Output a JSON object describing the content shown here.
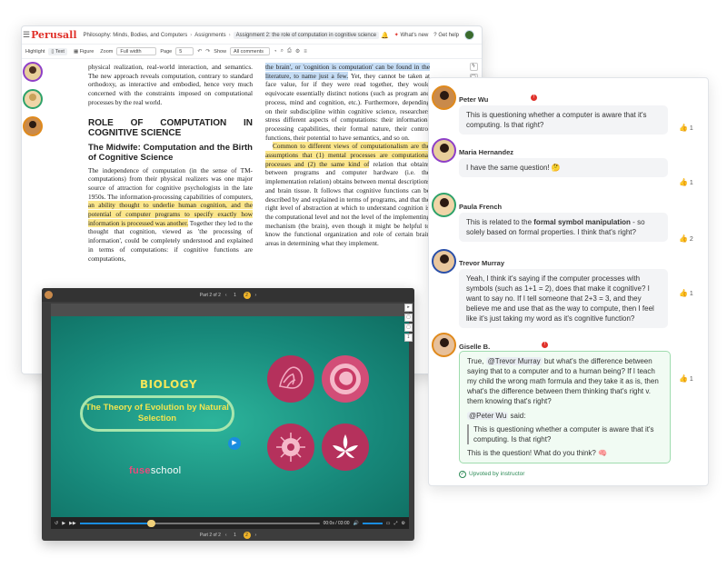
{
  "reader": {
    "logo": "Perusall",
    "breadcrumb": [
      "Philosophy: Minds, Bodies, and Computers",
      "Assignments",
      "Assignment 2: the role of computation in cognitive science"
    ],
    "whats_new": "What's new",
    "get_help": "Get help",
    "toolbar": {
      "highlight": "Highlight",
      "text": "Text",
      "figure": "Figure",
      "zoom_label": "Zoom",
      "zoom_value": "Full width",
      "page_label": "Page",
      "page_value": "5",
      "show_label": "Show",
      "show_value": "All comments"
    },
    "doc": {
      "col1_p1": "physical realization, real-world interaction, and semantics. The new approach reveals computation, contrary to standard orthodoxy, as interactive and embodied, hence very much concerned with the constraints imposed on computational processes by the real world.",
      "heading1": "ROLE OF COMPUTATION IN COGNITIVE SCIENCE",
      "heading2": "The Midwife: Computation and the Birth of Cognitive Science",
      "col1_p2a": "The independence of computation (in the sense of TM- computations) from their physical realizers was one major source of attraction for cognitive psychologists in the late 1950s. The information-processing capabilities of computers, ",
      "col1_p2_hl": "an ability thought to underlie human cognition, and the potential of computer programs to specify exactly how information is processed was another.",
      "col1_p2b": " Together they led to the thought that cognition, viewed as 'the processing of information', could be completely understood and explained in terms of computations: if cognitive functions are computations,",
      "col2_hl_b": "the brain', or 'cognition is computation' can be found in the literature, to name just a few.",
      "col2_p1": " Yet, they cannot be taken at face value, for if they were read together, they would equivocate essentially distinct notions (such as program and process, mind and cognition, etc.). Furthermore, depending on their subdiscipline within cognitive science, researchers stress different aspects of computations: their information-processing capabilities, their formal nature, their control functions, their potential to have semantics, and so on.",
      "col2_hl_y": "Common to different views of computationalism are the assumptions that (1) mental processes are computational processes and (2) the same kind of",
      "col2_p2": " relation that obtains between programs and computer hardware (i.e. the implementation relation) obtains between mental descriptions and brain tissue. It follows that cognitive functions can be described by and explained in terms of programs, and that the right level of abstraction at which to understand cognition is the computational level and not the level of the implementing mechanism (the brain), even though it might be helpful to know the functional organization and role of certain brain areas in determining what they implement."
    }
  },
  "video": {
    "part_label": "Part 2 of 2",
    "pages": [
      "1",
      "2"
    ],
    "current_page": "2",
    "subject": "BIOLOGY",
    "title": "The Theory of Evolution by Natural Selection",
    "brand_a": "fuse",
    "brand_b": "school",
    "time": "00:0s / 03:00",
    "progress": 0.3
  },
  "comments": [
    {
      "name": "Peter Wu",
      "text": "This is questioning whether a computer is aware that it's computing. Is that right?",
      "likes": "1",
      "badge": "!"
    },
    {
      "name": "Maria Hernandez",
      "text": "I have the same question! 🤔",
      "likes": "1"
    },
    {
      "name": "Paula French",
      "text_a": "This is related to the ",
      "text_bold": "formal symbol manipulation",
      "text_b": " - so solely based on formal properties. I think that's right?",
      "likes": "2"
    },
    {
      "name": "Trevor Murray",
      "text": "Yeah, I think it's saying if the computer processes with symbols (such as 1+1 = 2), does that make it cognitive? I want to say no. If I tell someone that 2+3 = 3, and they believe me and use that as the way to compute, then I feel like it's just taking my word as it's cognitive function?",
      "likes": "1"
    },
    {
      "name": "Giselle B.",
      "badge": "!",
      "mention": "@Trevor Murray",
      "text": " but what's the difference between saying that to a computer and to a human being? If I teach my child the wrong math formula and they take it as is, then what's the difference between them thinking that's right v. them knowing that's right?",
      "mention2": "@Peter Wu",
      "said": " said:",
      "quote": "This is questioning whether a computer is aware that it's computing. Is that right?",
      "follow": "This is the question! What do you think? 🧠",
      "upvoted": "Upvoted by instructor",
      "likes": "1"
    }
  ],
  "colors": {
    "brand_red": "#e0322b",
    "highlight_yellow": "#fbe68c",
    "highlight_blue": "#c5dcf4",
    "video_teal": "#17887a"
  }
}
